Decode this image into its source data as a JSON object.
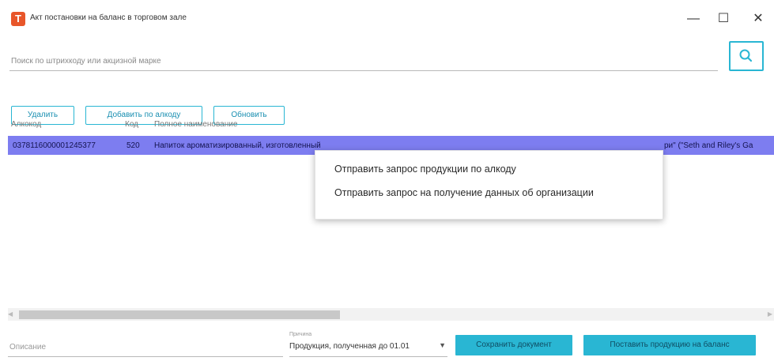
{
  "window": {
    "title": "Акт постановки на баланс в торговом зале",
    "app_icon_letter": "T",
    "minimize_glyph": "—",
    "maximize_glyph": "☐",
    "close_glyph": "✕"
  },
  "search": {
    "placeholder": "Поиск по штрихкоду или акцизной марке",
    "button_icon": "search-icon"
  },
  "actions": {
    "delete_label": "Удалить",
    "add_by_alcocode_label": "Добавить по алкоду",
    "refresh_label": "Обновить"
  },
  "table": {
    "columns": [
      "Алкокод",
      "Код",
      "Полное наименование"
    ],
    "rows": [
      {
        "alcocode": "0378116000001245377",
        "code": "520",
        "name": "Напиток ароматизированный, изготовленный",
        "name_tail": "ри\" (\"Seth and Riley's Ga"
      }
    ]
  },
  "context_menu": {
    "items": [
      "Отправить запрос продукции по алкоду",
      "Отправить запрос на получение данных об организации"
    ]
  },
  "scrollbar": {
    "left_arrow": "◀",
    "right_arrow": "▶"
  },
  "footer": {
    "comment_placeholder": "Описание",
    "reason_label": "Причина",
    "reason_value": "Продукция, полученная до 01.01",
    "reason_arrow": "▼",
    "save_label": "Сохранить документ",
    "post_label": "Поставить продукцию на баланс"
  },
  "colors": {
    "accent": "#29b6d3",
    "selected_row": "#7d7df0",
    "app_icon": "#e8562a"
  }
}
